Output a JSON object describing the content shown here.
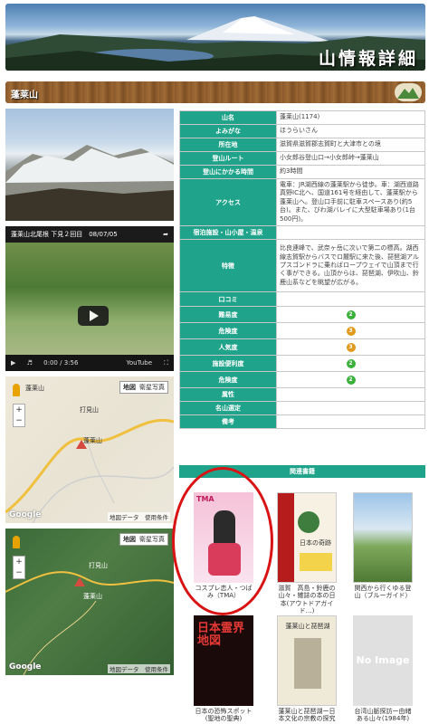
{
  "header": {
    "title": "山情報詳細"
  },
  "mountain_bar": {
    "name": "蓬莱山"
  },
  "video": {
    "title": "蓬莱山北尾根 下見２回目　08/07/05",
    "time": "0:00",
    "duration": "3:56",
    "brand": "YouTube"
  },
  "maps": [
    {
      "type_map": "地図",
      "type_sat": "衛星写真",
      "labels": [
        "蓬莱山",
        "打見山",
        "蓬莱山"
      ],
      "footer": "地図データ　使用条件",
      "logo": "Google"
    },
    {
      "type_map": "地図",
      "type_sat": "衛星写真",
      "labels": [
        "打見山",
        "蓬莱山"
      ],
      "footer": "地図データ　使用条件",
      "logo": "Google"
    }
  ],
  "info": {
    "name_label": "山名",
    "name": "蓬莱山(1174)",
    "yomi_label": "よみがな",
    "yomi": "ほうらいさん",
    "location_label": "所在地",
    "location": "滋賀県滋賀郡志賀町と大津市との境",
    "route_label": "登山ルート",
    "route": "小女郎谷登山口→小女郎峠→蓬莱山",
    "time_label": "登山にかかる時間",
    "time": "約3時間",
    "access_label": "アクセス",
    "access": "電車：JR湖西線の蓬莱駅から徒歩。車：湖西道路真野IC北へ、国道161号を経由して、蓬莱駅から蓬莱山へ。登山口手前に駐車スペースあり(約5台)。また、びわ湖バレイに大型駐車場あり(1台500円)。",
    "onsen_label": "宿泊施設・山小屋・温泉",
    "onsen": "",
    "feature_label": "特徴",
    "feature": "比良連峰で、武奈ヶ岳に次いで第二の標高。湖西線志賀駅からバスでロ麓駅に来た後、琵琶湖アルプスゴンドラに乗ればロープウェイで山頂まで行く事ができる。山頂からは、琵琶湖、伊吹山、鈴鹿山系などを眺望が広がる。",
    "review_label": "口コミ",
    "review": "",
    "difficulty_label": "難易度",
    "difficulty": "2",
    "danger_label": "危険度",
    "danger": "3",
    "popularity_label": "人気度",
    "popularity": "3",
    "facility_label": "施設便利度",
    "facility": "2",
    "hazard_label": "危険度",
    "hazard": "2",
    "attribute_label": "属性",
    "attribute": "",
    "meizan_label": "名山選定",
    "meizan": "",
    "notes_label": "備考",
    "notes": ""
  },
  "related": {
    "heading": "関連書籍",
    "books": [
      {
        "title": "コスプレ恋人・つばみ（TMA）",
        "cover_text": "TMA"
      },
      {
        "title": "滋賀　高島・鈴鹿の山々・雑誌の本の日本(アウトドアガイド…)",
        "cover_text": "日本の奇跡"
      },
      {
        "title": "関西から行くゆる登山（ブルーガイド）",
        "cover_text": ""
      },
      {
        "title": "日本の恐怖スポット(聖地の聖典)",
        "cover_text": "日本霊界地図"
      },
      {
        "title": "蓬莱山と琵琶湖ー日本文化の宗教の探究",
        "cover_text": "蓬莱山と琵琶湖"
      },
      {
        "title": "台湾山脈探訪ー由緒ある山々(1984年)",
        "cover_text": "No Image"
      }
    ]
  },
  "colors": {
    "table_key": "#1fa38a",
    "circle": "#d91313"
  }
}
